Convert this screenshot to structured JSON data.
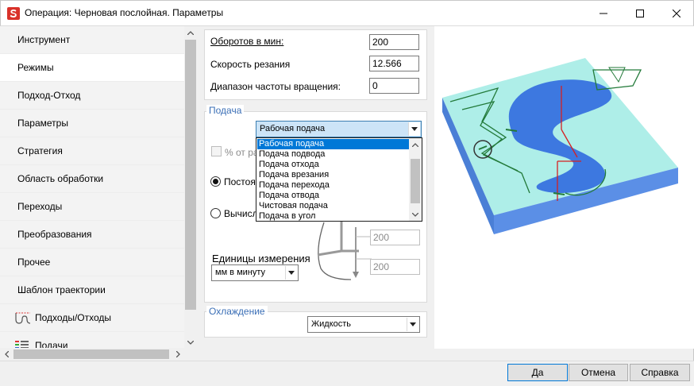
{
  "window": {
    "title": "Операция: Черновая послойная. Параметры",
    "minimize_icon": "minimize-icon",
    "maximize_icon": "maximize-icon",
    "close_icon": "close-icon"
  },
  "sidebar": {
    "items": [
      {
        "label": "Инструмент"
      },
      {
        "label": "Режимы"
      },
      {
        "label": "Подход-Отход"
      },
      {
        "label": "Параметры"
      },
      {
        "label": "Стратегия"
      },
      {
        "label": "Область обработки"
      },
      {
        "label": "Переходы"
      },
      {
        "label": "Преобразования"
      },
      {
        "label": "Прочее"
      },
      {
        "label": "Шаблон траектории"
      },
      {
        "label": "Подходы/Отходы",
        "icon": "approach-path-icon"
      },
      {
        "label": "Подачи",
        "icon": "feeds-list-icon"
      }
    ],
    "selected_index": 1
  },
  "spindle": {
    "rpm_label": "Оборотов в мин:",
    "rpm_value": "200",
    "speed_label": "Скорость резания",
    "speed_value": "12.566",
    "range_label": "Диапазон частоты вращения:",
    "range_value": "0"
  },
  "feed": {
    "group_title": "Подача",
    "selected": "Рабочая подача",
    "options": [
      "Рабочая подача",
      "Подача подвода",
      "Подача отхода",
      "Подача врезания",
      "Подача перехода",
      "Подача отвода",
      "Чистовая подача",
      "Подача в угол"
    ],
    "percent_label": "% от ра",
    "constant_label": "Постоя",
    "calculated_label": "Вычисл",
    "value_top": "200",
    "value_bottom": "200",
    "units_label": "Единицы измерения",
    "units_value": "мм в минуту"
  },
  "cooling": {
    "group_title": "Охлаждение",
    "value": "Жидкость"
  },
  "buttons": {
    "ok": "Да",
    "cancel": "Отмена",
    "help": "Справка"
  }
}
